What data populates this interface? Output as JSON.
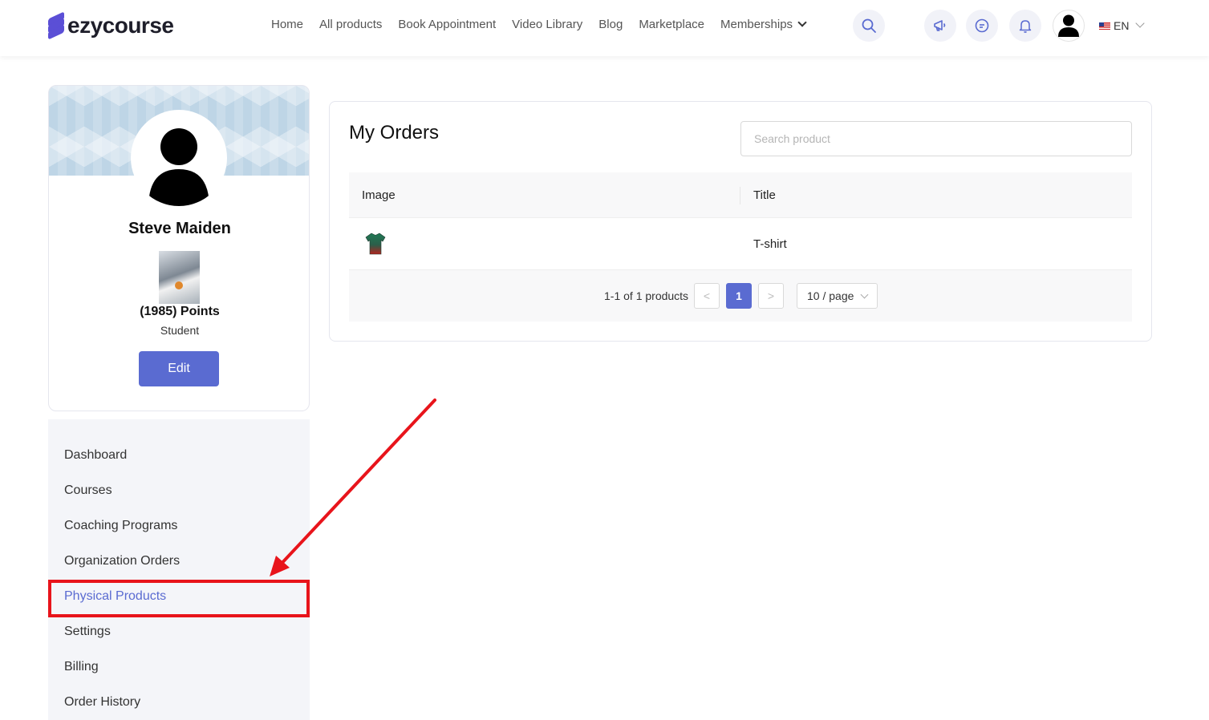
{
  "header": {
    "logo_text": "ezycourse",
    "nav": [
      {
        "label": "Home"
      },
      {
        "label": "All products"
      },
      {
        "label": "Book Appointment"
      },
      {
        "label": "Video Library"
      },
      {
        "label": "Blog"
      },
      {
        "label": "Marketplace"
      },
      {
        "label": "Memberships"
      }
    ],
    "language": "EN",
    "icons": [
      "search-icon",
      "megaphone-icon",
      "chat-icon",
      "bell-icon",
      "user-avatar-icon",
      "us-flag-icon"
    ]
  },
  "profile": {
    "name": "Steve Maiden",
    "points": "(1985) Points",
    "role": "Student",
    "edit_label": "Edit"
  },
  "menu": {
    "items": [
      {
        "label": "Dashboard"
      },
      {
        "label": "Courses"
      },
      {
        "label": "Coaching Programs"
      },
      {
        "label": "Organization Orders"
      },
      {
        "label": "Physical Products"
      },
      {
        "label": "Settings"
      },
      {
        "label": "Billing"
      },
      {
        "label": "Order History"
      }
    ],
    "active": "Physical Products"
  },
  "orders": {
    "title": "My Orders",
    "search_placeholder": "Search product",
    "columns": [
      "Image",
      "Title"
    ],
    "rows": [
      {
        "image": "tshirt-thumbnail",
        "title": "T-shirt"
      }
    ],
    "pagination": {
      "summary": "1-1 of 1 products",
      "prev": "<",
      "current_page": "1",
      "next": ">",
      "page_size": "10 / page"
    }
  },
  "colors": {
    "accent": "#5a6bd1",
    "annotation": "#e8141b",
    "menu_bg": "#f4f5f9"
  }
}
